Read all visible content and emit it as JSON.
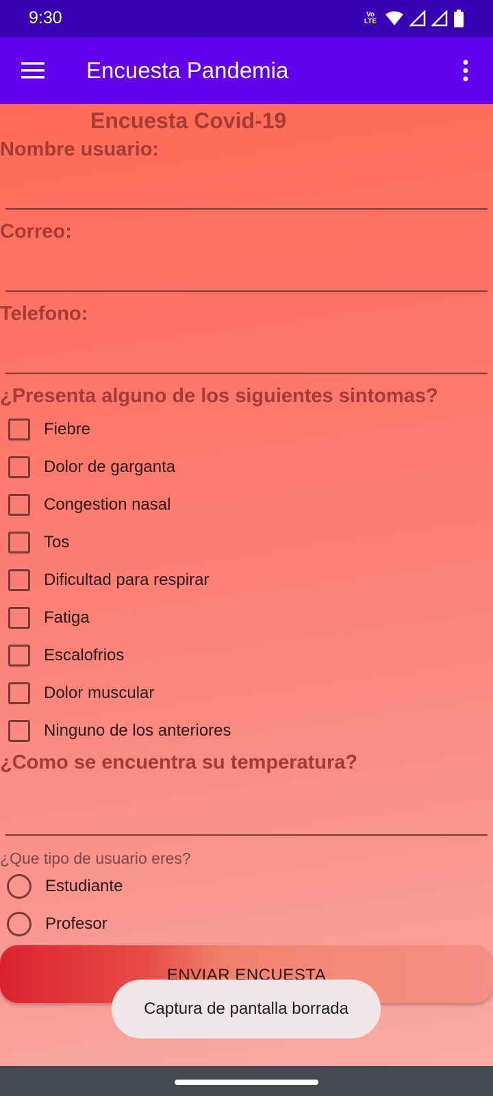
{
  "status_bar": {
    "time": "9:30",
    "volte_top": "Vo",
    "volte_bottom": "LTE"
  },
  "app_bar": {
    "title": "Encuesta Pandemia"
  },
  "form": {
    "title": "Encuesta Covid-19",
    "name_label": "Nombre usuario:",
    "name_value": "",
    "email_label": "Correo:",
    "email_value": "",
    "phone_label": "Telefono:",
    "phone_value": "",
    "symptoms_question": "¿Presenta alguno de los siguientes sintomas?",
    "symptoms": [
      {
        "label": "Fiebre",
        "checked": false
      },
      {
        "label": "Dolor de garganta",
        "checked": false
      },
      {
        "label": "Congestion nasal",
        "checked": false
      },
      {
        "label": "Tos",
        "checked": false
      },
      {
        "label": "Dificultad para respirar",
        "checked": false
      },
      {
        "label": "Fatiga",
        "checked": false
      },
      {
        "label": "Escalofrios",
        "checked": false
      },
      {
        "label": "Dolor muscular",
        "checked": false
      },
      {
        "label": "Ninguno de los anteriores",
        "checked": false
      }
    ],
    "temperature_question": "¿Como se encuentra su temperatura?",
    "temperature_value": "",
    "user_type_question": "¿Que tipo de usuario eres?",
    "user_types": [
      {
        "label": "Estudiante",
        "selected": false
      },
      {
        "label": "Profesor",
        "selected": false
      }
    ],
    "submit_label": "ENVIAR ENCUESTA"
  },
  "toast": {
    "message": "Captura de pantalla borrada"
  },
  "icons": {
    "menu": "hamburger-menu-icon",
    "overflow": "more-vert-icon",
    "wifi": "wifi-icon",
    "signal": "cell-signal-icon",
    "battery": "battery-icon"
  }
}
